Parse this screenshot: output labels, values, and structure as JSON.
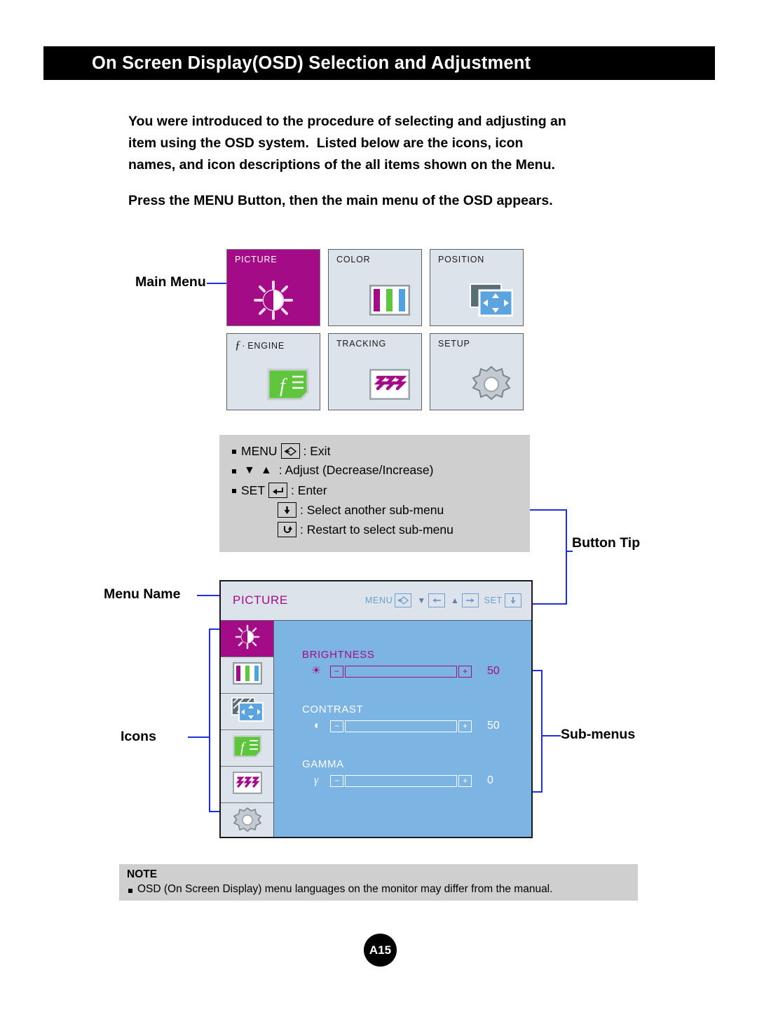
{
  "header": {
    "title": "On Screen Display(OSD) Selection and Adjustment"
  },
  "intro": {
    "line1": "You were introduced to the procedure of selecting and adjusting an",
    "line2": "item using the OSD system.  Listed below are the icons, icon",
    "line3": "names, and icon descriptions of the all items shown on the Menu.",
    "press_line": "Press the MENU Button, then the main menu of the OSD appears."
  },
  "callouts": {
    "main_menu": "Main Menu",
    "menu_name": "Menu Name",
    "icons": "Icons",
    "button_tip": "Button Tip",
    "sub_menus": "Sub-menus"
  },
  "main_menu": {
    "tiles": [
      {
        "label": "PICTURE",
        "icon": "brightness-sun-icon",
        "selected": true
      },
      {
        "label": "COLOR",
        "icon": "color-bars-icon",
        "selected": false
      },
      {
        "label": "POSITION",
        "icon": "position-arrows-icon",
        "selected": false
      },
      {
        "label": "ENGINE",
        "icon": "f-engine-card-icon",
        "selected": false
      },
      {
        "label": "TRACKING",
        "icon": "tracking-waves-icon",
        "selected": false
      },
      {
        "label": "SETUP",
        "icon": "gear-icon",
        "selected": false
      }
    ]
  },
  "button_tip": {
    "lines": [
      {
        "bullet": true,
        "prefix": "MENU",
        "key": "exit-diamond-icon",
        "suffix": ": Exit"
      },
      {
        "bullet": true,
        "prefix": "",
        "key": "down-up-arrows",
        "suffix": ": Adjust (Decrease/Increase)"
      },
      {
        "bullet": true,
        "prefix": "SET",
        "key": "enter-return-icon",
        "suffix": ": Enter"
      },
      {
        "bullet": false,
        "prefix": "",
        "key": "down-arrow-boxed-icon",
        "suffix": ": Select another sub-menu"
      },
      {
        "bullet": false,
        "prefix": "",
        "key": "restart-loop-icon",
        "suffix": ": Restart to select sub-menu"
      }
    ]
  },
  "osd": {
    "menu_name": "PICTURE",
    "keys": [
      {
        "label": "MENU",
        "icon": "exit-arrow-icon"
      },
      {
        "label": "",
        "tri": "down-triangle",
        "icon": "left-arrow-icon"
      },
      {
        "label": "",
        "tri": "up-triangle",
        "icon": "right-arrow-icon"
      },
      {
        "label": "SET",
        "icon": "down-arrow-icon"
      }
    ],
    "rail_icons": [
      {
        "name": "brightness-sun-icon",
        "selected": true
      },
      {
        "name": "color-bars-icon",
        "selected": false
      },
      {
        "name": "position-arrows-icon",
        "selected": false
      },
      {
        "name": "f-engine-card-icon",
        "selected": false
      },
      {
        "name": "tracking-waves-icon",
        "selected": false
      },
      {
        "name": "gear-icon",
        "selected": false
      }
    ],
    "submenus": [
      {
        "title": "BRIGHTNESS",
        "icon": "sun-icon",
        "value": "50",
        "fill_pct": 50,
        "active": true,
        "minus": "−",
        "plus": "+"
      },
      {
        "title": "CONTRAST",
        "icon": "half-moon-icon",
        "value": "50",
        "fill_pct": 50,
        "active": false,
        "minus": "−",
        "plus": "+"
      },
      {
        "title": "GAMMA",
        "icon": "gamma-icon",
        "value": "0",
        "fill_pct": 50,
        "active": false,
        "minus": "−",
        "plus": "+"
      }
    ]
  },
  "note": {
    "title": "NOTE",
    "text": "OSD (On Screen Display) menu languages on the monitor may differ from the manual."
  },
  "page": {
    "number": "A15"
  },
  "colors": {
    "magenta": "#a40b86",
    "osd_blue": "#7cb4e4",
    "panel_grey": "#dde3ea",
    "tip_grey": "#cfcfcf",
    "connector_blue": "#2030e0"
  }
}
